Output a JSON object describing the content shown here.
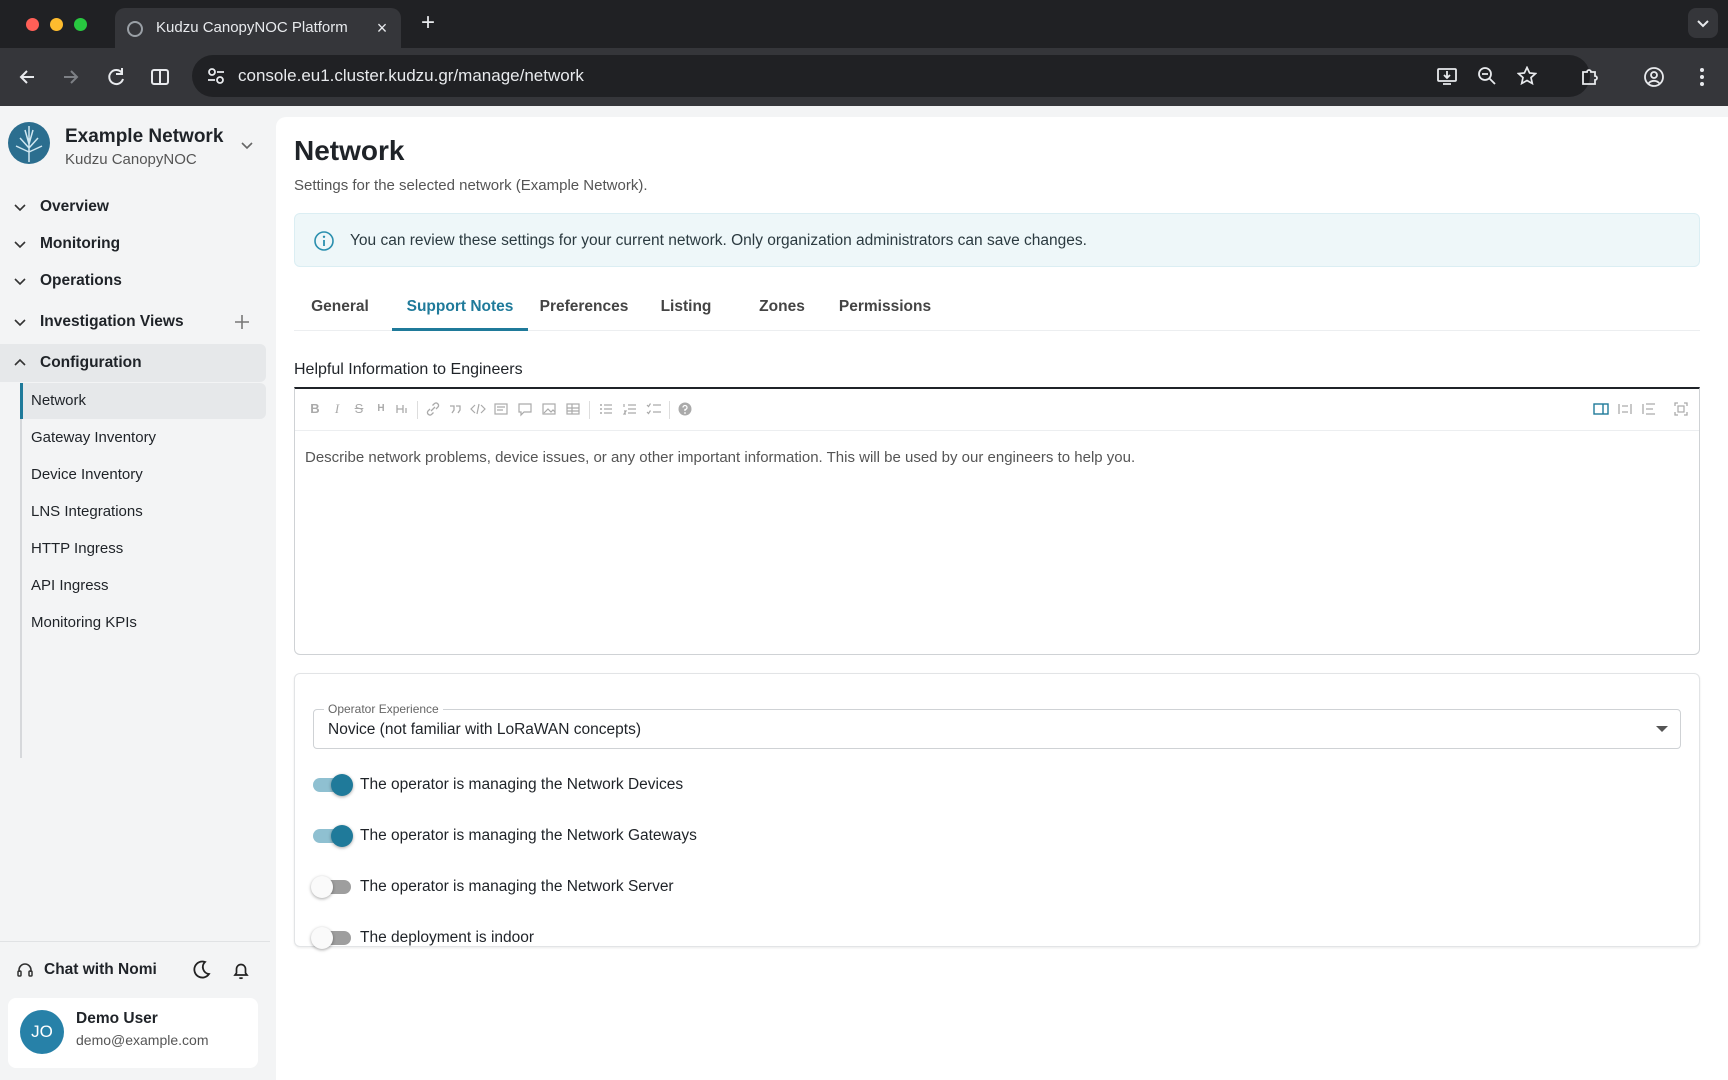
{
  "browser": {
    "tab_title": "Kudzu CanopyNOC Platform",
    "url": "console.eu1.cluster.kudzu.gr/manage/network"
  },
  "sidebar": {
    "org_name": "Example Network",
    "org_product": "Kudzu CanopyNOC",
    "sections": [
      {
        "label": "Overview"
      },
      {
        "label": "Monitoring"
      },
      {
        "label": "Operations"
      },
      {
        "label": "Investigation Views"
      },
      {
        "label": "Configuration"
      }
    ],
    "config_items": [
      {
        "label": "Network"
      },
      {
        "label": "Gateway Inventory"
      },
      {
        "label": "Device Inventory"
      },
      {
        "label": "LNS Integrations"
      },
      {
        "label": "HTTP Ingress"
      },
      {
        "label": "API Ingress"
      },
      {
        "label": "Monitoring KPIs"
      }
    ],
    "chat_label": "Chat with Nomi",
    "user": {
      "initials": "JO",
      "name": "Demo User",
      "email": "demo@example.com"
    }
  },
  "main": {
    "title": "Network",
    "subtitle": "Settings for the selected network (Example Network).",
    "info_text": "You can review these settings for your current network. Only organization administrators can save changes.",
    "tabs": [
      {
        "label": "General"
      },
      {
        "label": "Support Notes"
      },
      {
        "label": "Preferences"
      },
      {
        "label": "Listing"
      },
      {
        "label": "Zones"
      },
      {
        "label": "Permissions"
      }
    ],
    "active_tab": "Support Notes",
    "section_label": "Helpful Information to Engineers",
    "editor_placeholder": "Describe network problems, device issues, or any other important information. This will be used by our engineers to help you.",
    "editor_toolbar": {
      "bold": "B",
      "italic": "I",
      "strike": "S",
      "heading": "H"
    },
    "operator_experience": {
      "label": "Operator Experience",
      "value": "Novice (not familiar with LoRaWAN concepts)"
    },
    "toggles": [
      {
        "label": "The operator is managing the Network Devices",
        "on": true
      },
      {
        "label": "The operator is managing the Network Gateways",
        "on": true
      },
      {
        "label": "The operator is managing the Network Server",
        "on": false
      },
      {
        "label": "The deployment is indoor",
        "on": false
      }
    ]
  },
  "colors": {
    "accent": "#1f7a9a",
    "banner_bg": "#eef7f9"
  }
}
